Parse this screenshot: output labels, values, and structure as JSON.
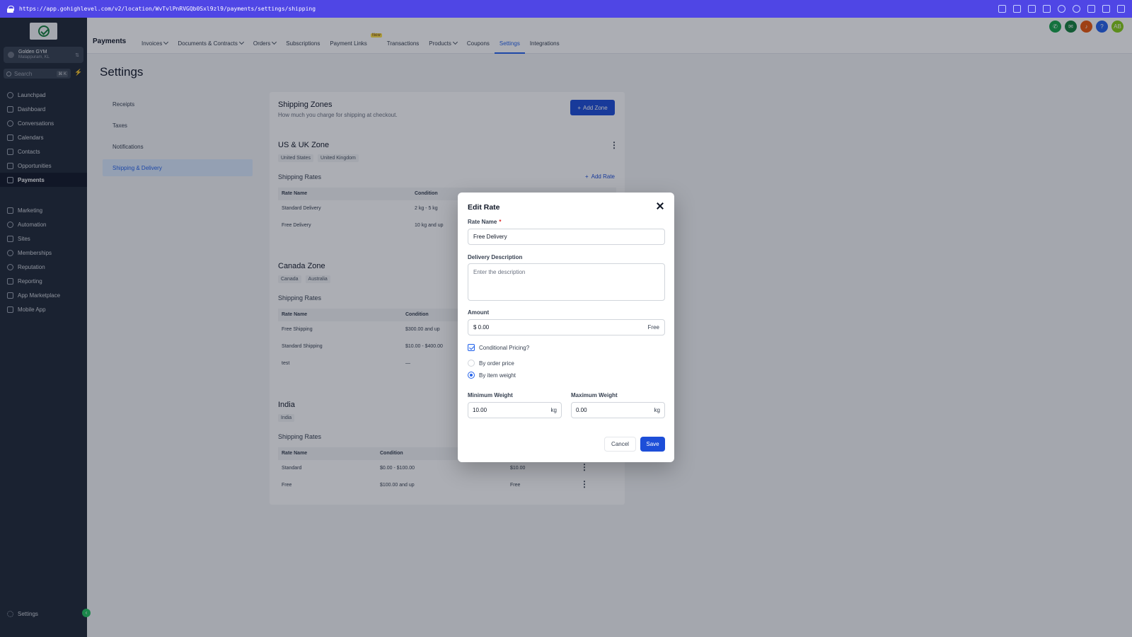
{
  "browser": {
    "url": "https://app.gohighlevel.com/v2/location/WvTvlPnRVGQb0Sxl9zl9/payments/settings/shipping"
  },
  "sidebar": {
    "account_name": "Golden GYM",
    "account_location": "Malappuram, KL",
    "search_placeholder": "Search",
    "search_shortcut": "⌘ K",
    "items": [
      {
        "label": "Launchpad",
        "icon": "rocket-icon"
      },
      {
        "label": "Dashboard",
        "icon": "dashboard-icon"
      },
      {
        "label": "Conversations",
        "icon": "chat-icon"
      },
      {
        "label": "Calendars",
        "icon": "calendar-icon"
      },
      {
        "label": "Contacts",
        "icon": "contacts-icon"
      },
      {
        "label": "Opportunities",
        "icon": "opportunities-icon"
      },
      {
        "label": "Payments",
        "icon": "payments-icon"
      }
    ],
    "items2": [
      {
        "label": "Marketing",
        "icon": "send-icon"
      },
      {
        "label": "Automation",
        "icon": "automation-icon"
      },
      {
        "label": "Sites",
        "icon": "sites-icon"
      },
      {
        "label": "Memberships",
        "icon": "memberships-icon"
      },
      {
        "label": "Reputation",
        "icon": "star-icon"
      },
      {
        "label": "Reporting",
        "icon": "chart-icon"
      },
      {
        "label": "App Marketplace",
        "icon": "grid-icon"
      },
      {
        "label": "Mobile App",
        "icon": "phone-icon"
      }
    ],
    "settings_label": "Settings"
  },
  "topnav": {
    "title": "Payments",
    "tabs": [
      {
        "label": "Invoices"
      },
      {
        "label": "Documents & Contracts"
      },
      {
        "label": "Orders"
      },
      {
        "label": "Subscriptions"
      },
      {
        "label": "Payment Links",
        "badge": "New"
      },
      {
        "label": "Transactions"
      },
      {
        "label": "Products"
      },
      {
        "label": "Coupons"
      },
      {
        "label": "Settings"
      },
      {
        "label": "Integrations"
      }
    ],
    "avatar": "AB"
  },
  "page": {
    "title": "Settings",
    "menu": [
      "Receipts",
      "Taxes",
      "Notifications",
      "Shipping & Delivery"
    ]
  },
  "shipping": {
    "title": "Shipping Zones",
    "description": "How much you charge for shipping at checkout.",
    "add_zone": "Add Zone",
    "rates_label": "Shipping Rates",
    "add_rate": "Add Rate",
    "col_rate_name": "Rate Name",
    "col_condition": "Condition",
    "zones": [
      {
        "name": "US & UK Zone",
        "countries": [
          "United States",
          "United Kingdom"
        ],
        "rates": [
          {
            "name": "Standard Delivery",
            "condition": "2 kg - 5 kg"
          },
          {
            "name": "Free Delivery",
            "condition": "10 kg and up"
          }
        ]
      },
      {
        "name": "Canada Zone",
        "countries": [
          "Canada",
          "Australia"
        ],
        "rates": [
          {
            "name": "Free Shipping",
            "condition": "$300.00 and up"
          },
          {
            "name": "Standard Shipping",
            "condition": "$10.00 - $400.00"
          },
          {
            "name": "test",
            "condition": "—"
          }
        ]
      },
      {
        "name": "India",
        "countries": [
          "India"
        ],
        "rates": [
          {
            "name": "Standard",
            "condition": "$0.00 - $100.00",
            "price": "$10.00"
          },
          {
            "name": "Free",
            "condition": "$100.00 and up",
            "price": "Free"
          }
        ]
      }
    ]
  },
  "modal": {
    "title": "Edit Rate",
    "rate_name_label": "Rate Name",
    "required_mark": "*",
    "rate_name_value": "Free Delivery",
    "description_label": "Delivery Description",
    "description_placeholder": "Enter the description",
    "amount_label": "Amount",
    "amount_value": "$ 0.00",
    "amount_suffix": "Free",
    "conditional_label": "Conditional Pricing?",
    "conditional_checked": true,
    "option_price": "By order price",
    "option_weight": "By item weight",
    "selected_option": "By item weight",
    "min_weight_label": "Minimum Weight",
    "min_weight_value": "10.00",
    "max_weight_label": "Maximum Weight",
    "max_weight_value": "0.00",
    "unit": "kg",
    "cancel": "Cancel",
    "save": "Save"
  },
  "colors": {
    "primary": "#1d4ed8",
    "sidebar": "#1f2937",
    "browser_bar": "#4f46e5"
  }
}
